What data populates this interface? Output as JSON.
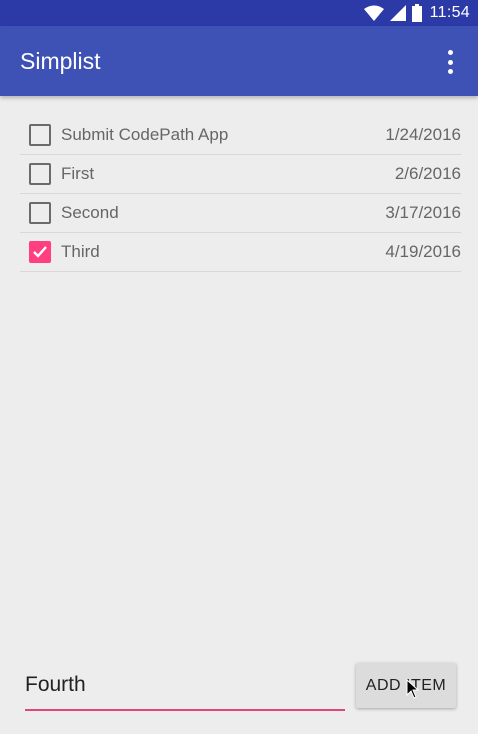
{
  "status_bar": {
    "time": "11:54",
    "icons": [
      "wifi-icon",
      "cellular-signal-icon",
      "battery-icon"
    ]
  },
  "app_bar": {
    "title": "Simplist",
    "overflow_icon": "more-vert-icon",
    "color": "#3e51b5"
  },
  "items": [
    {
      "label": "Submit CodePath App",
      "date": "1/24/2016",
      "checked": false
    },
    {
      "label": "First",
      "date": "2/6/2016",
      "checked": false
    },
    {
      "label": "Second",
      "date": "3/17/2016",
      "checked": false
    },
    {
      "label": "Third",
      "date": "4/19/2016",
      "checked": true
    }
  ],
  "new_item": {
    "value": "Fourth",
    "accent_color": "#e0457c"
  },
  "add_button": {
    "label": "ADD ITEM"
  },
  "colors": {
    "checked": "#ff3f80",
    "status_bar": "#2c3aa8"
  }
}
